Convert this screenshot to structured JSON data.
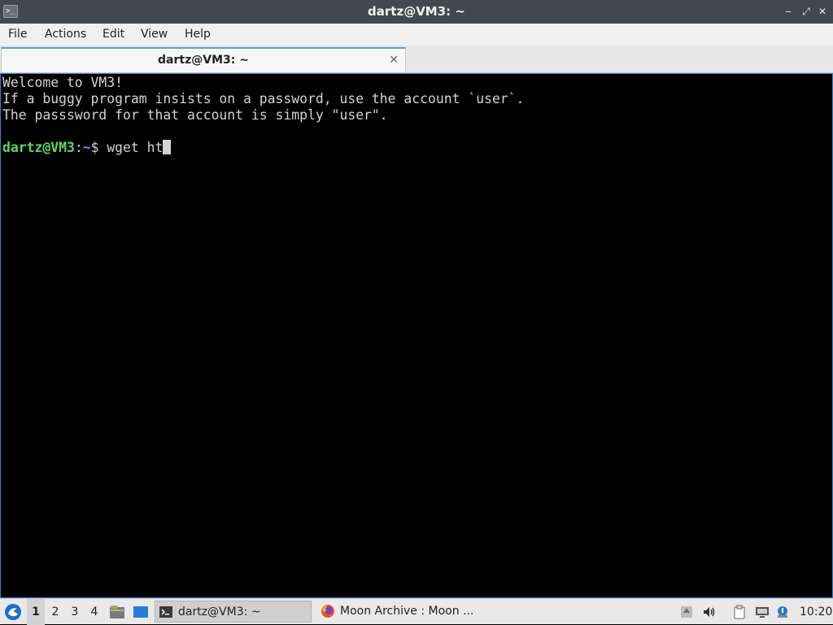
{
  "window": {
    "title": "dartz@VM3: ~",
    "controls": {
      "minimize": "‒",
      "maximize": "⤢",
      "close": "✕"
    }
  },
  "menubar": [
    "File",
    "Actions",
    "Edit",
    "View",
    "Help"
  ],
  "tabs": [
    {
      "label": "dartz@VM3: ~",
      "close": "✕"
    }
  ],
  "terminal": {
    "lines": [
      "Welcome to VM3!",
      "If a buggy program insists on a password, use the account `user`.",
      "The passsword for that account is simply \"user\"."
    ],
    "prompt": {
      "user_host": "dartz@VM3",
      "sep": ":",
      "path": "~",
      "symbol": "$ ",
      "command": "wget ht"
    },
    "colors": {
      "prompt_user": "#5fd75f",
      "prompt_path": "#6f8fff",
      "text": "#d3d3d3",
      "bg": "#000000"
    }
  },
  "taskbar": {
    "workspaces": [
      "1",
      "2",
      "3",
      "4"
    ],
    "active_workspace": "1",
    "quicklaunch": [
      "file-manager-icon",
      "desktop-icon"
    ],
    "tasks": [
      {
        "label": "dartz@VM3: ~",
        "icon": "terminal-icon",
        "active": true
      },
      {
        "label": "Moon Archive : Moon ...",
        "icon": "firefox-icon",
        "active": false
      }
    ],
    "tray": [
      "updates-icon",
      "volume-icon",
      "clipboard-icon",
      "network-icon",
      "notification-icon"
    ],
    "clock": "10:20"
  }
}
